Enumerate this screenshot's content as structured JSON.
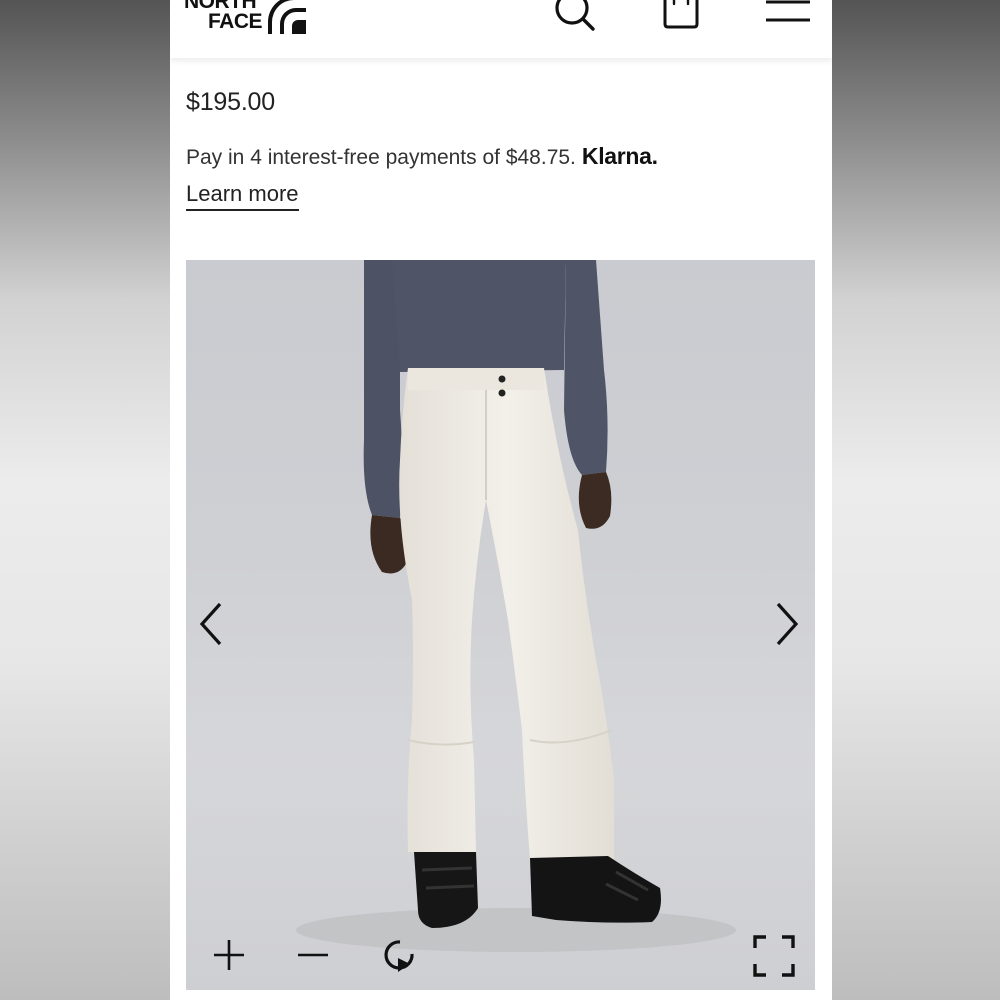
{
  "header": {
    "logo_line1": "NORTH",
    "logo_line2": "FACE",
    "icons": [
      "logo-mark-icon",
      "search-icon",
      "shopping-bag-icon",
      "menu-icon"
    ]
  },
  "product": {
    "price": "$195.00",
    "installment_text": "Pay in 4 interest-free payments of $48.75.",
    "klarna_logo": "Klarna.",
    "learn_more": "Learn more"
  },
  "gallery": {
    "image_alt": "",
    "controls": [
      "chevron-left-icon",
      "chevron-right-icon",
      "plus-icon",
      "minus-icon",
      "rotate-icon",
      "fullscreen-icon"
    ]
  },
  "colors": {
    "text": "#222222",
    "gallery_bg": "#cfd0d4",
    "pants": "#eeebe4",
    "top": "#4f5566"
  }
}
